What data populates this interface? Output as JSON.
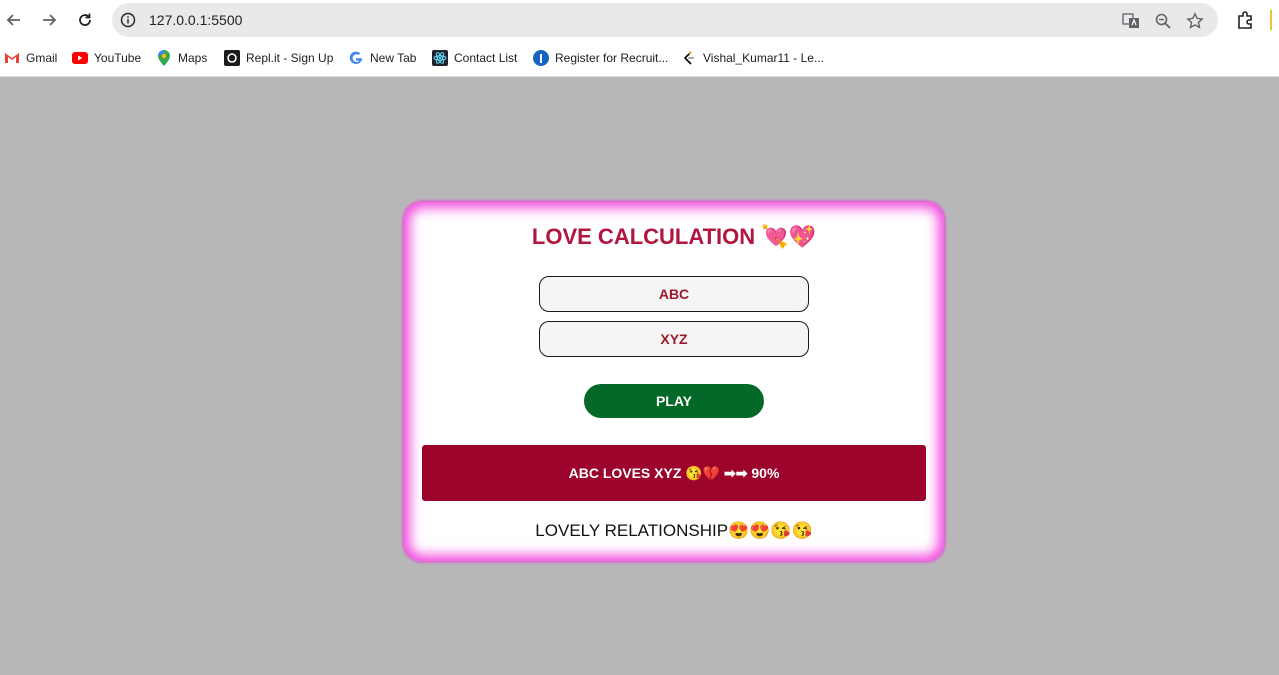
{
  "browser": {
    "url": "127.0.0.1:5500",
    "bookmarks": [
      {
        "label": "Gmail",
        "icon": "gmail-icon"
      },
      {
        "label": "YouTube",
        "icon": "youtube-icon"
      },
      {
        "label": "Maps",
        "icon": "maps-icon"
      },
      {
        "label": "Repl.it - Sign Up",
        "icon": "replit-icon"
      },
      {
        "label": "New Tab",
        "icon": "google-icon"
      },
      {
        "label": "Contact List",
        "icon": "react-icon"
      },
      {
        "label": "Register for Recruit...",
        "icon": "register-icon"
      },
      {
        "label": "Vishal_Kumar11 - Le...",
        "icon": "leetcode-icon"
      }
    ]
  },
  "app": {
    "title": "LOVE CALCULATION 💘💖",
    "name1": "ABC",
    "name2": "XYZ",
    "play_label": "PLAY",
    "result": "ABC LOVES XYZ 😘💔 ➡➡ 90%",
    "verdict": "LOVELY RELATIONSHIP😍😍😘😘",
    "colors": {
      "title": "#b0163f",
      "play_button": "#046928",
      "result_bg": "#9c042b",
      "card_glow": "#f24de0",
      "page_bg": "#b8b7b8"
    }
  }
}
